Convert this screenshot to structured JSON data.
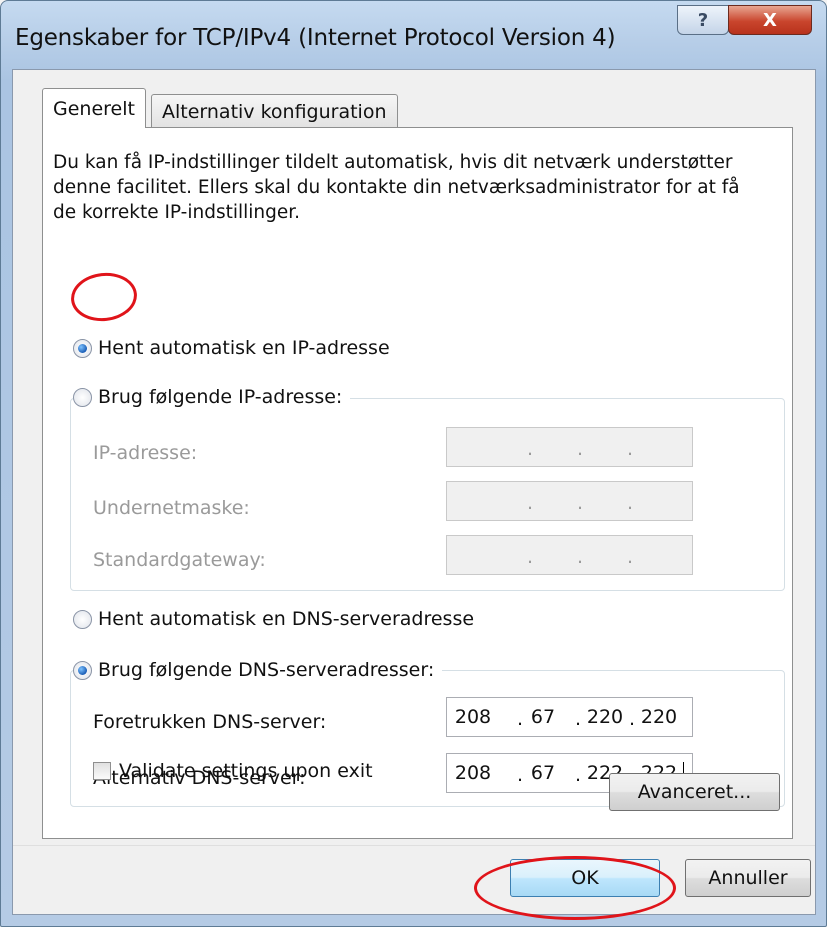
{
  "window": {
    "title": "Egenskaber for TCP/IPv4 (Internet Protocol Version 4)",
    "help_icon": "?",
    "close_icon": "X"
  },
  "tabs": [
    {
      "label": "Generelt",
      "selected": true
    },
    {
      "label": "Alternativ konfiguration",
      "selected": false
    }
  ],
  "intro": "Du kan få IP-indstillinger tildelt automatisk, hvis dit netværk understøtter denne facilitet. Ellers skal du kontakte din netværksadministrator for at få de korrekte IP-indstillinger.",
  "ip": {
    "auto_label": "Hent automatisk en IP-adresse",
    "manual_label": "Brug følgende IP-adresse:",
    "selected": "auto",
    "fields": [
      {
        "label": "IP-adresse:",
        "value": ". . ."
      },
      {
        "label": "Undernetmaske:",
        "value": ". . ."
      },
      {
        "label": "Standardgateway:",
        "value": ". . ."
      }
    ]
  },
  "dns": {
    "auto_label": "Hent automatisk en DNS-serveradresse",
    "manual_label": "Brug følgende DNS-serveradresser:",
    "selected": "manual",
    "fields": [
      {
        "label": "Foretrukken DNS-server:",
        "octets": [
          "208",
          "67",
          "220",
          "220"
        ]
      },
      {
        "label": "Alternativ DNS-server:",
        "octets": [
          "208",
          "67",
          "222",
          "222"
        ]
      }
    ]
  },
  "validate": {
    "label": "Validate settings upon exit",
    "checked": false
  },
  "buttons": {
    "advanced": "Avanceret...",
    "ok": "OK",
    "cancel": "Annuller"
  },
  "colors": {
    "annotation": "#e0141a",
    "title_gradient": "#b7cee8"
  }
}
